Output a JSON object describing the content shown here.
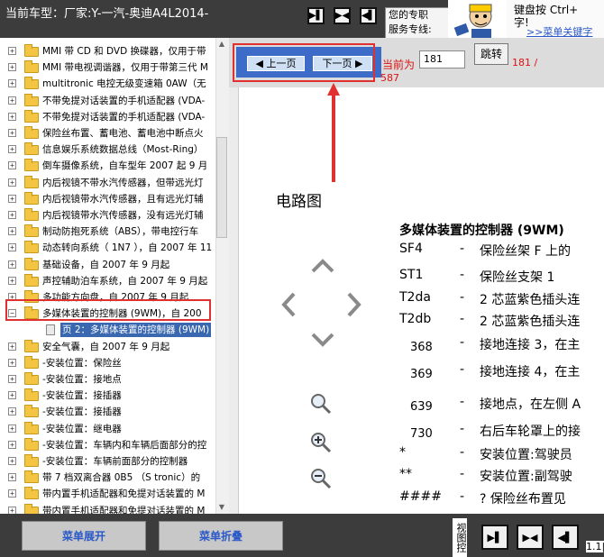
{
  "header": {
    "car_label": "当前车型：厂家:Y-一汽-奥迪A4L2014-",
    "help_text_1": "您的专职",
    "help_text_2": "服务专线:",
    "tip_line_1": "键盘按 Ctrl+",
    "tip_line_2": "字!",
    "tip_link": ">>菜单关键字",
    "view_buttons": [
      "▶▌",
      "▶◀",
      "◀▌"
    ]
  },
  "tree": {
    "items": [
      {
        "label": "MMI 带 CD 和 DVD 换碟器，仅用于带"
      },
      {
        "label": "MMI 带电视调谐器，仅用于带第三代 M"
      },
      {
        "label": "multitronic 电控无级变速箱 0AW（无"
      },
      {
        "label": "不带免提对话装置的手机适配器 (VDA-"
      },
      {
        "label": "不带免提对话装置的手机适配器 (VDA-"
      },
      {
        "label": "保险丝布置、蓄电池、蓄电池中断点火"
      },
      {
        "label": "信息娱乐系统数据总线（Most-Ring）"
      },
      {
        "label": "倒车摄像系统，自车型年 2007 起 9 月"
      },
      {
        "label": "内后视镜不带水汽传感器，但带远光灯"
      },
      {
        "label": "内后视镜带水汽传感器，且有远光灯辅"
      },
      {
        "label": "内后视镜带水汽传感器，没有远光灯辅"
      },
      {
        "label": "制动防抱死系统（ABS），带电控行车"
      },
      {
        "label": "动态转向系统（ 1N7 ），自 2007 年 11"
      },
      {
        "label": "基础设备，自 2007 年 9 月起"
      },
      {
        "label": "声控辅助泊车系统，自 2007 年 9 月起"
      },
      {
        "label": "多功能方向盘，自 2007 年 9 月起"
      },
      {
        "label": "多媒体装置的控制器 (9WM)，自 200"
      },
      {
        "label": "页 2：多媒体装置的控制器 (9WM)",
        "child": true
      },
      {
        "label": "安全气囊，自 2007 年 9 月起"
      },
      {
        "label": "-安装位置：保险丝"
      },
      {
        "label": "-安装位置：接地点"
      },
      {
        "label": "-安装位置：接插器"
      },
      {
        "label": "-安装位置：接插器"
      },
      {
        "label": "-安装位置：继电器"
      },
      {
        "label": "-安装位置：车辆内和车辆后面部分的控"
      },
      {
        "label": "-安装位置：车辆前面部分的控制器"
      },
      {
        "label": "带 7 档双离合器 0B5 （S tronic）的"
      },
      {
        "label": "带内置手机适配器和免提对话装置的 M"
      },
      {
        "label": "带内置手机适配器和免提对话装置的 M"
      }
    ]
  },
  "pager": {
    "prev_label": "上一页",
    "next_label": "下一页",
    "current_label": "当前为",
    "current_page": "181",
    "jump_label": "跳转",
    "total_text": "181 /",
    "total_text_2": "587"
  },
  "document": {
    "diagram_title": "电路图",
    "heading": "多媒体装置的控制器 (9WM)",
    "items": [
      {
        "code": "SF4",
        "desc": "保险丝架 F 上的"
      },
      {
        "code": "ST1",
        "desc": "保险丝支架 1"
      },
      {
        "code": "T2da",
        "desc": "2 芯蓝紫色插头连"
      },
      {
        "code": "T2db",
        "desc": "2 芯蓝紫色插头连"
      },
      {
        "code": "368",
        "desc": "接地连接 3，在主"
      },
      {
        "code": "369",
        "desc": "接地连接 4，在主"
      },
      {
        "code": "639",
        "desc": "接地点，在左侧 A"
      },
      {
        "code": "730",
        "desc": "右后车轮罩上的接"
      },
      {
        "code": "*",
        "desc": "安装位置:驾驶员"
      },
      {
        "code": "**",
        "desc": "安装位置:副驾驶"
      },
      {
        "code": "####",
        "desc": "? 保险丝布置见"
      }
    ]
  },
  "footer": {
    "expand_label": "菜单展开",
    "collapse_label": "菜单折叠",
    "view_control_label": "视图控",
    "zoom_text": "1.1|"
  },
  "colors": {
    "dark_bar": "#3c3c3c",
    "nav_blue": "#3c6bc8",
    "highlight_red": "#e03030",
    "selected_blue": "#3a68b0"
  }
}
